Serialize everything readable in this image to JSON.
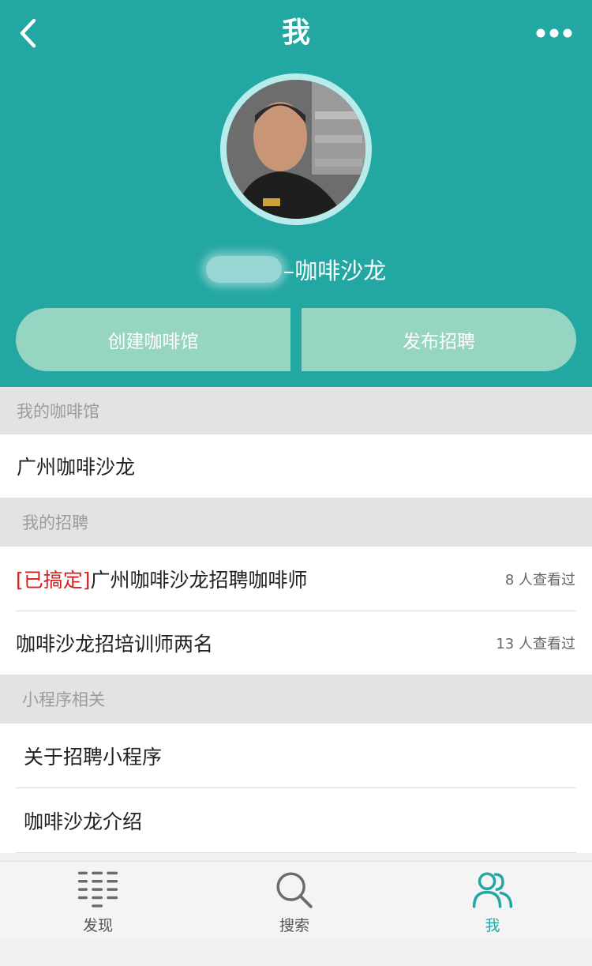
{
  "header": {
    "title": "我",
    "username_suffix": "–咖啡沙龙",
    "buttons": {
      "create_cafe": "创建咖啡馆",
      "post_job": "发布招聘"
    }
  },
  "sections": {
    "my_cafe": {
      "label": "我的咖啡馆",
      "items": [
        {
          "name": "广州咖啡沙龙"
        }
      ]
    },
    "my_jobs": {
      "label": "我的招聘",
      "items": [
        {
          "tag": "[已搞定]",
          "title": "广州咖啡沙龙招聘咖啡师",
          "views": "8 人查看过"
        },
        {
          "tag": "",
          "title": "咖啡沙龙招培训师两名",
          "views": "13 人查看过"
        }
      ]
    },
    "mini_program": {
      "label": "小程序相关",
      "items": [
        {
          "title": "关于招聘小程序"
        },
        {
          "title": "咖啡沙龙介绍"
        }
      ]
    }
  },
  "tabbar": {
    "items": [
      {
        "label": "发现",
        "icon": "list-icon",
        "active": false
      },
      {
        "label": "搜索",
        "icon": "search-icon",
        "active": false
      },
      {
        "label": "我",
        "icon": "users-icon",
        "active": true
      }
    ]
  },
  "colors": {
    "primary": "#23a7a3",
    "button": "#96d5c1",
    "tag_red": "#d41f1f",
    "section_bg": "#e3e3e3"
  }
}
